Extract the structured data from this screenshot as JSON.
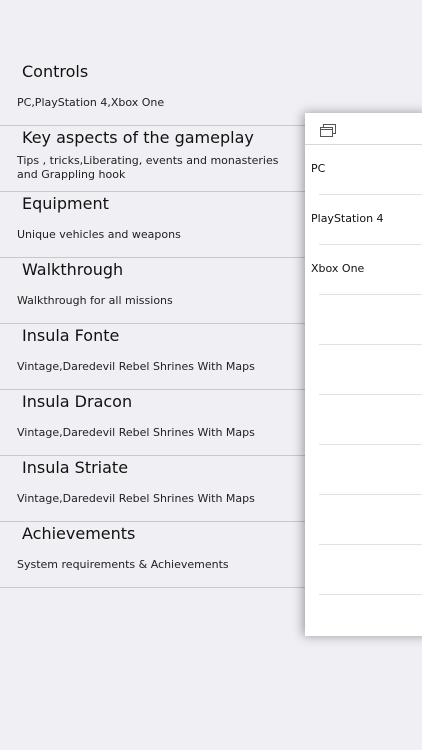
{
  "menu": {
    "items": [
      {
        "title": "Controls",
        "subtitle": "PC,PlayStation 4,Xbox One"
      },
      {
        "title": "Key aspects of the gameplay",
        "subtitle": "Tips , tricks,Liberating, events and monasteries and Grappling hook"
      },
      {
        "title": "Equipment",
        "subtitle": "Unique vehicles and weapons"
      },
      {
        "title": "Walkthrough",
        "subtitle": "Walkthrough for all missions"
      },
      {
        "title": "Insula Fonte",
        "subtitle": "Vintage,Daredevil Rebel Shrines With Maps"
      },
      {
        "title": "Insula Dracon",
        "subtitle": "Vintage,Daredevil Rebel Shrines With Maps"
      },
      {
        "title": "Insula Striate",
        "subtitle": "Vintage,Daredevil Rebel Shrines With Maps"
      },
      {
        "title": "Achievements",
        "subtitle": "System requirements & Achievements"
      }
    ]
  },
  "panel": {
    "header_icon": "windows-icon",
    "rows": [
      "PC",
      "PlayStation 4",
      "Xbox One",
      "",
      "",
      "",
      "",
      "",
      ""
    ]
  }
}
